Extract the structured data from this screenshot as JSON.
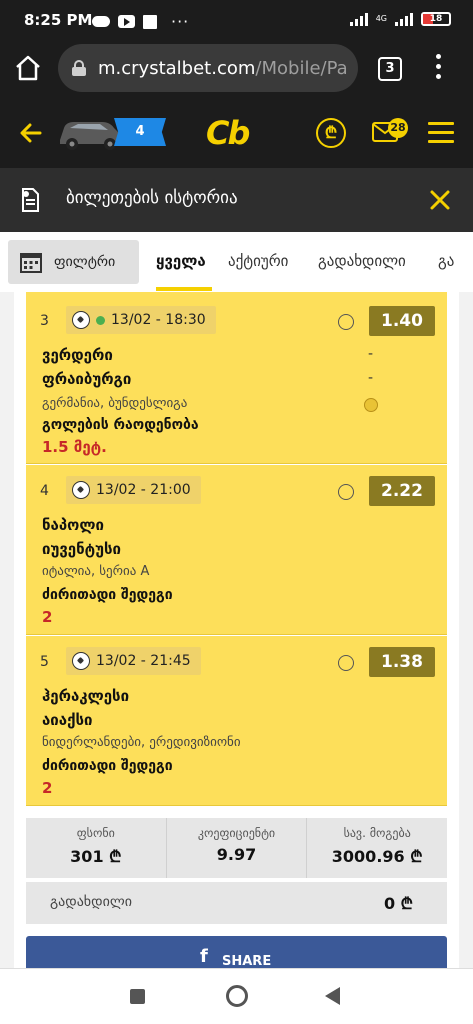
{
  "status": {
    "time": "8:25 PM",
    "more": "···",
    "network": "4G",
    "battery": "18"
  },
  "browser": {
    "url_host": "m.crystalbet.com",
    "url_path": "/Mobile/Pa",
    "tab_count": "3"
  },
  "header": {
    "promo_count": "4",
    "logo": "Cb",
    "mail_badge": "28",
    "accent_color": "#f5d000"
  },
  "history": {
    "title": "ბილეთების ისტორია"
  },
  "tabs": {
    "filter_label": "ფილტრი",
    "items": [
      "ყველა",
      "აქტიური",
      "გადახდილი",
      "გა"
    ]
  },
  "bets": [
    {
      "num": "3",
      "datetime": "13/02 - 18:30",
      "live": true,
      "odds": "1.40",
      "home": "ვერდერი",
      "away": "ფრაიბურგი",
      "home_score": "-",
      "away_score": "-",
      "league": "გერმანია, ბუნდესლიგა",
      "market": "გოლების რაოდენობა",
      "pick": "1.5 მეტ."
    },
    {
      "num": "4",
      "datetime": "13/02 - 21:00",
      "live": false,
      "odds": "2.22",
      "home": "ნაპოლი",
      "away": "იუვენტუსი",
      "home_score": "",
      "away_score": "",
      "league": "იტალია, სერია A",
      "market": "ძირითადი შედეგი",
      "pick": "2"
    },
    {
      "num": "5",
      "datetime": "13/02 - 21:45",
      "live": false,
      "odds": "1.38",
      "home": "ჰერაკლესი",
      "away": "აიაქსი",
      "home_score": "",
      "away_score": "",
      "league": "ნიდერლანდები, ერედივიზიონი",
      "market": "ძირითადი შედეგი",
      "pick": "2"
    }
  ],
  "summary": {
    "stake_label": "ფსონი",
    "stake_value": "301 ₾",
    "coef_label": "კოეფიციენტი",
    "coef_value": "9.97",
    "potwin_label": "სავ. მოგება",
    "potwin_value": "3000.96 ₾",
    "paid_label": "გადახდილი",
    "paid_value": "0 ₾"
  },
  "share": {
    "fb_icon": "f",
    "label": "SHARE"
  }
}
